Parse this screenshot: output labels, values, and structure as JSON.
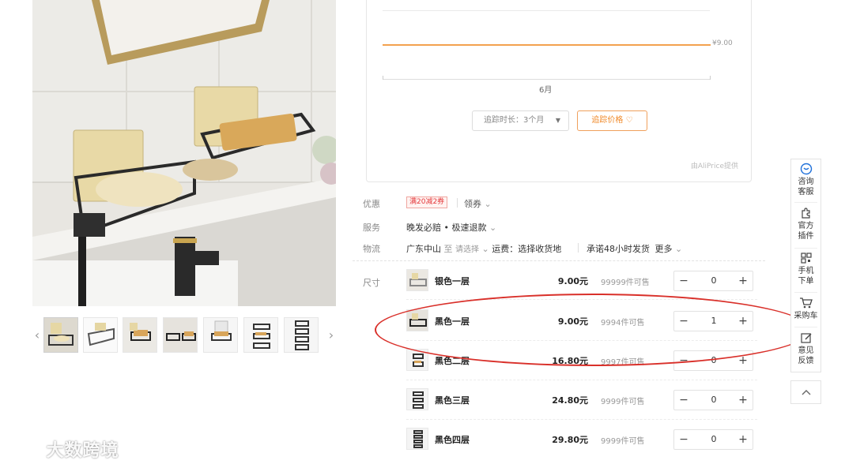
{
  "tracker": {
    "price_label": "¥9.00",
    "month_label": "6月",
    "duration_select": "追踪时长：3个月",
    "track_price_button": "追踪价格",
    "provider": "由AliPrice提供",
    "line_color": "#f3a14e"
  },
  "info": {
    "promo_label": "优惠",
    "coupon_badge": "满20减2券",
    "get_coupon": "领券",
    "service_label": "服务",
    "service_text": "晚发必赔 • 极速退款",
    "logistics_label": "物流",
    "origin": "广东中山",
    "to": "至",
    "dest_select": "请选择",
    "shipping_fee": "运费：选择收货地",
    "ship_promise": "承诺48小时发货",
    "more": "更多",
    "size_label": "尺寸"
  },
  "skus": [
    {
      "name": "银色一层",
      "price": "9.00元",
      "stock": "99999件可售",
      "qty": "0"
    },
    {
      "name": "黑色一层",
      "price": "9.00元",
      "stock": "9994件可售",
      "qty": "1"
    },
    {
      "name": "黑色二层",
      "price": "16.80元",
      "stock": "9997件可售",
      "qty": "0"
    },
    {
      "name": "黑色三层",
      "price": "24.80元",
      "stock": "9999件可售",
      "qty": "0"
    },
    {
      "name": "黑色四层",
      "price": "29.80元",
      "stock": "9999件可售",
      "qty": "0"
    }
  ],
  "sidebar": {
    "consult": "咨询客服",
    "plugin": "官方插件",
    "mobile": "手机下单",
    "cart": "采购车",
    "feedback": "意见反馈"
  },
  "watermark": "大数跨境",
  "colors": {
    "accent": "#f08a2a",
    "highlight": "#d9302a",
    "coupon": "#e4393c",
    "sidebar_icon": "#1e6fd9"
  }
}
